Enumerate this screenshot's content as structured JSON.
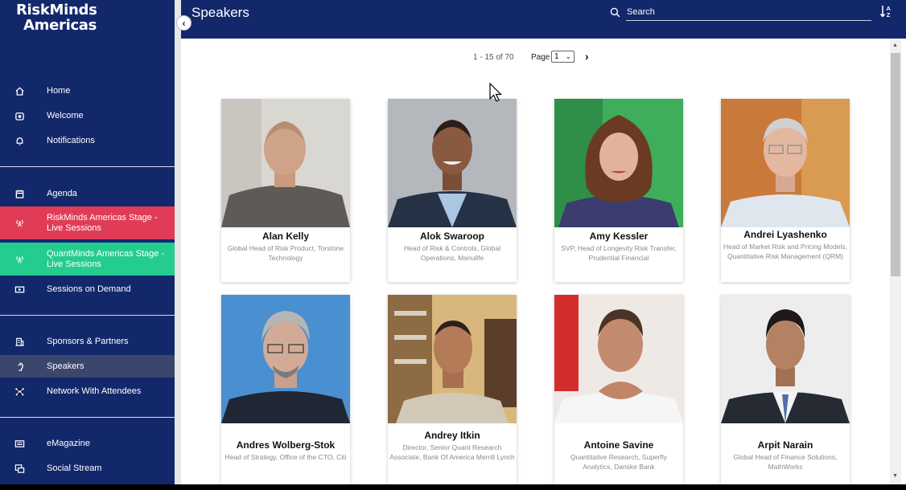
{
  "app": {
    "logo_line1": "RiskMinds",
    "logo_line2": "Americas"
  },
  "sidebar": {
    "items": [
      {
        "label": "Home",
        "icon": "home-icon"
      },
      {
        "label": "Welcome",
        "icon": "welcome-icon"
      },
      {
        "label": "Notifications",
        "icon": "bell-icon"
      },
      {
        "label": "Agenda",
        "icon": "calendar-icon"
      },
      {
        "label": "RiskMinds Americas Stage - Live Sessions",
        "icon": "broadcast-icon"
      },
      {
        "label": "QuantMinds Americas Stage - Live Sessions",
        "icon": "broadcast-icon"
      },
      {
        "label": "Sessions on Demand",
        "icon": "video-icon"
      },
      {
        "label": "Sponsors & Partners",
        "icon": "building-icon"
      },
      {
        "label": "Speakers",
        "icon": "speaker-icon"
      },
      {
        "label": "Network With Attendees",
        "icon": "network-icon"
      },
      {
        "label": "eMagazine",
        "icon": "magazine-icon"
      },
      {
        "label": "Social Stream",
        "icon": "social-icon"
      }
    ]
  },
  "header": {
    "title": "Speakers",
    "search_placeholder": "Search"
  },
  "pagination": {
    "range": "1 - 15 of 70",
    "page_label": "Page",
    "page_value": "1"
  },
  "speakers": [
    {
      "name": "Alan Kelly",
      "role": "Global Head of Risk Product, Torstone Technology"
    },
    {
      "name": "Alok Swaroop",
      "role": "Head of Risk & Controls, Global Operations, Manulife"
    },
    {
      "name": "Amy Kessler",
      "role": "SVP, Head of Longevity Risk Transfer, Prudential Financial"
    },
    {
      "name": "Andrei Lyashenko",
      "role": "Head of Market Risk and Pricing Models, Quantitative Risk Management (QRM)"
    },
    {
      "name": "Andres Wolberg-Stok",
      "role": "Head of Strategy, Office of the CTO, Citi"
    },
    {
      "name": "Andrey Itkin",
      "role": "Director, Senior Quant Research Associate, Bank Of America Merrill Lynch"
    },
    {
      "name": "Antoine Savine",
      "role": "Quantitative Research, Superfly Analytics, Danske Bank"
    },
    {
      "name": "Arpit Narain",
      "role": "Global Head of Finance Solutions, MathWorks"
    }
  ],
  "colors": {
    "primary": "#13286b",
    "live_red": "#e13c57",
    "live_green": "#25cc90",
    "active": "#3b466d"
  }
}
